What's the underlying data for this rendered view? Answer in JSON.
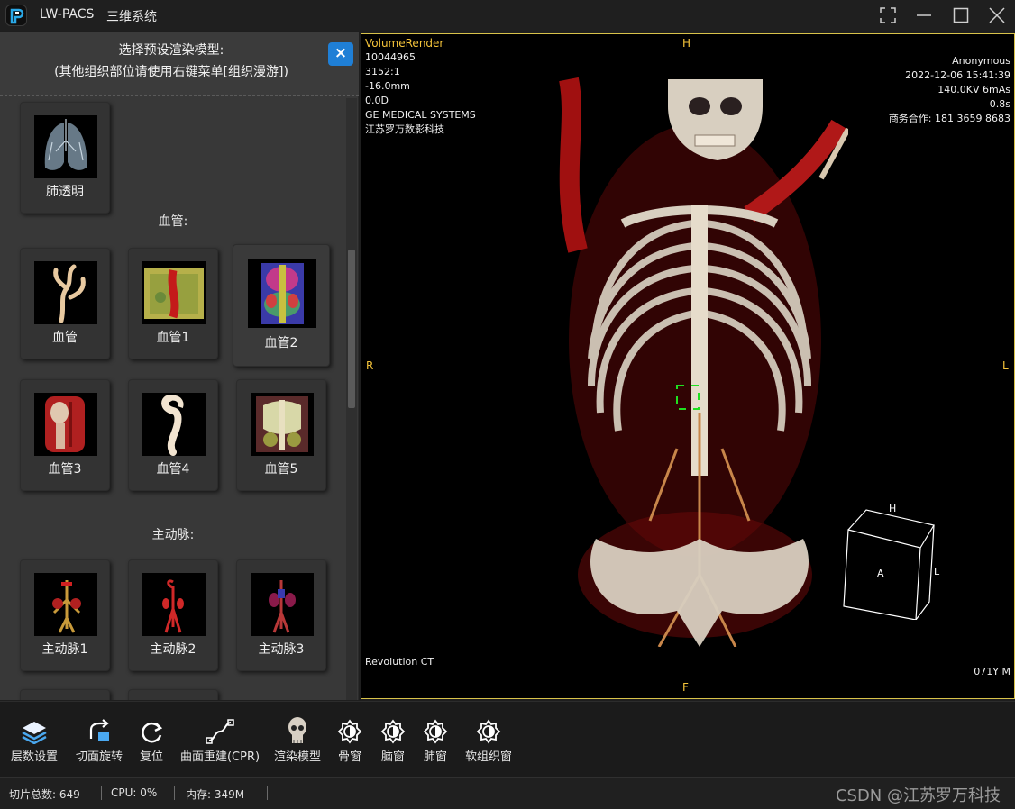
{
  "titlebar": {
    "app_name": "LW-PACS",
    "app_subtitle": "三维系统",
    "buttons": [
      "fullscreen-icon",
      "minimize-icon",
      "maximize-icon",
      "close-icon"
    ]
  },
  "panel": {
    "header_line1": "选择预设渲染模型:",
    "header_line2": "(其他组织部位请使用右键菜单[组织漫游])",
    "close_label": "×",
    "sections": [
      {
        "title": "",
        "items": [
          {
            "label": "肺透明"
          }
        ]
      },
      {
        "title": "血管:",
        "items": [
          {
            "label": "血管"
          },
          {
            "label": "血管1"
          },
          {
            "label": "血管2"
          },
          {
            "label": "血管3"
          },
          {
            "label": "血管4"
          },
          {
            "label": "血管5"
          }
        ]
      },
      {
        "title": "主动脉:",
        "items": [
          {
            "label": "主动脉1"
          },
          {
            "label": "主动脉2"
          },
          {
            "label": "主动脉3"
          }
        ]
      }
    ]
  },
  "viewport": {
    "mode": "VolumeRender",
    "top_left": [
      "10044965",
      "3152:1",
      "-16.0mm",
      "0.0D",
      "GE MEDICAL SYSTEMS",
      "江苏罗万数影科技"
    ],
    "top_right": [
      "Anonymous",
      "2022-12-06 15:41:39",
      "140.0KV 6mAs",
      "0.8s",
      "商务合作: 181 3659 8683"
    ],
    "bottom_left": "Revolution CT",
    "bottom_right": "071Y M",
    "dir_top": "H",
    "dir_bottom": "F",
    "dir_left": "R",
    "dir_right": "L",
    "cube": {
      "top": "H",
      "face": "A",
      "side": "L"
    }
  },
  "toolbar": [
    {
      "label": "层数设置",
      "icon": "layers-icon"
    },
    {
      "label": "切面旋转",
      "icon": "rotate-plane-icon"
    },
    {
      "label": "复位",
      "icon": "reset-icon"
    },
    {
      "label": "曲面重建(CPR)",
      "icon": "curve-icon"
    },
    {
      "label": "渲染模型",
      "icon": "skull-icon"
    },
    {
      "label": "骨窗",
      "icon": "window-icon"
    },
    {
      "label": "脑窗",
      "icon": "window-icon"
    },
    {
      "label": "肺窗",
      "icon": "window-icon"
    },
    {
      "label": "软组织窗",
      "icon": "window-icon"
    }
  ],
  "status": {
    "slices": "切片总数: 649",
    "cpu": "CPU: 0%",
    "memory": "内存: 349M",
    "watermark": "CSDN @江苏罗万科技"
  },
  "colors": {
    "accent": "#1f7fd6",
    "viewport_border": "#d8c24a",
    "overlay_yellow": "#f5c43a"
  }
}
